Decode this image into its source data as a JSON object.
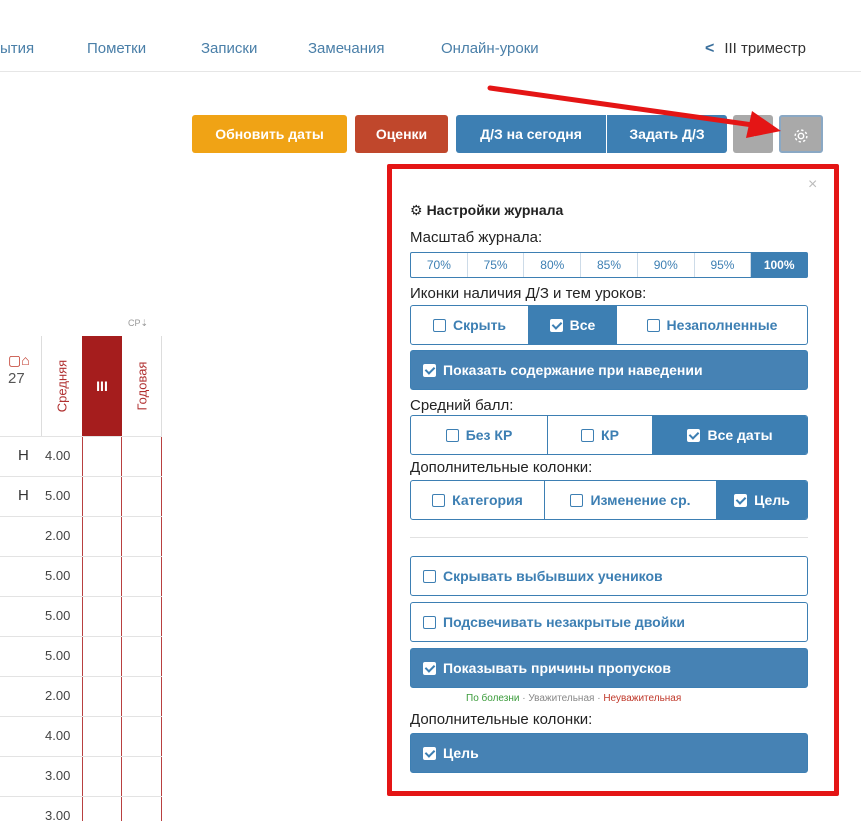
{
  "nav": {
    "tabs": [
      "ытия",
      "Пометки",
      "Записки",
      "Замечания",
      "Онлайн-уроки"
    ],
    "term": "III триместр"
  },
  "toolbar": {
    "update_dates": "Обновить даты",
    "grades": "Оценки",
    "hw_today": "Д/З на сегодня",
    "assign_hw": "Задать Д/З"
  },
  "table": {
    "date_header": "27",
    "cp_label": "СР⇣",
    "col_avg": "Средняя",
    "col_term": "III",
    "col_year": "Годовая",
    "rows": [
      {
        "mark": "Н",
        "avg": "4.00"
      },
      {
        "mark": "Н",
        "avg": "5.00"
      },
      {
        "mark": "",
        "avg": "2.00"
      },
      {
        "mark": "",
        "avg": "5.00"
      },
      {
        "mark": "",
        "avg": "5.00"
      },
      {
        "mark": "",
        "avg": "5.00"
      },
      {
        "mark": "",
        "avg": "2.00"
      },
      {
        "mark": "",
        "avg": "4.00"
      },
      {
        "mark": "",
        "avg": "3.00"
      },
      {
        "mark": "",
        "avg": "3.00"
      }
    ]
  },
  "settings": {
    "close": "×",
    "title": "Настройки журнала",
    "scale_label": "Масштаб журнала:",
    "scale_options": [
      "70%",
      "75%",
      "80%",
      "85%",
      "90%",
      "95%",
      "100%"
    ],
    "icons_label": "Иконки наличия Д/З и тем уроков:",
    "icons_options": [
      "Скрыть",
      "Все",
      "Незаполненные"
    ],
    "show_content": "Показать содержание при наведении",
    "avg_label": "Средний балл:",
    "avg_options": [
      "Без КР",
      "КР",
      "Все даты"
    ],
    "extra_label": "Дополнительные колонки:",
    "extra_options": [
      "Категория",
      "Изменение ср.",
      "Цель"
    ],
    "hide_left": "Скрывать выбывших учеников",
    "highlight_twos": "Подсвечивать незакрытые двойки",
    "show_reasons": "Показывать причины пропусков",
    "reasons": [
      "По болезни",
      "Уважительная",
      "Неуважительная"
    ],
    "reasons_sep": " · ",
    "extra_label2": "Дополнительные колонки:",
    "goal": "Цель"
  }
}
